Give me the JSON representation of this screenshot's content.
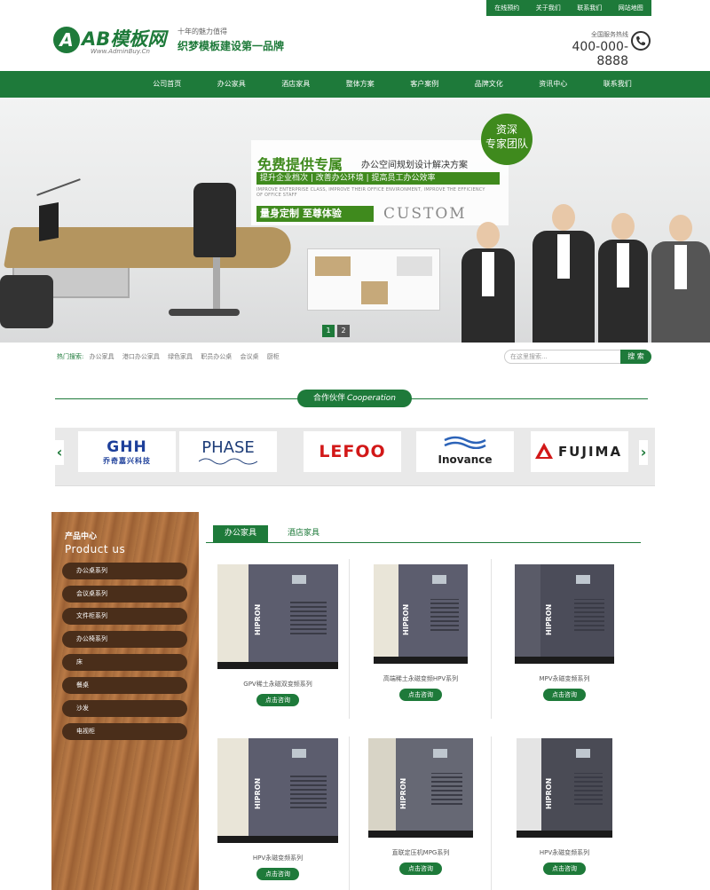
{
  "top_links": [
    "在线预约",
    "关于我们",
    "联系我们",
    "网站地图"
  ],
  "logo": {
    "mark": "A",
    "text": "AB模板网",
    "url": "Www.AdminBuy.Cn"
  },
  "tagline": {
    "line1": "十年的魅力值得",
    "line2": "织梦模板建设第一品牌"
  },
  "hotline": {
    "label": "全国服务热线",
    "number": "400-000-8888"
  },
  "nav": [
    "公司首页",
    "办公家具",
    "酒店家具",
    "整体方案",
    "客户案例",
    "品牌文化",
    "资讯中心",
    "联系我们"
  ],
  "banner": {
    "headline_bold": "免费提供专属",
    "headline_rest": "办公空间规划设计解决方案",
    "strip": "提升企业档次 | 改善办公环境 | 提高员工办公效率",
    "english": "IMPROVE ENTERPRISE CLASS, IMPROVE THEIR OFFICE ENVIRONMENT, IMPROVE THE EFFICIENCY OF OFFICE STAFF",
    "pill": "量身定制 至尊体验",
    "custom": "CUSTOM",
    "badge_line1": "资深",
    "badge_line2": "专家团队",
    "pages": [
      "1",
      "2"
    ]
  },
  "hot_search": {
    "label": "热门搜索:",
    "keywords": [
      "办公家具",
      "港口办公家具",
      "绿色家具",
      "职员办公桌",
      "会议桌",
      "厨柜"
    ]
  },
  "search": {
    "placeholder": "在这里搜索...",
    "button": "搜 索"
  },
  "cooperation": {
    "title_cn": "合作伙伴",
    "title_en": "Cooperation"
  },
  "brands": [
    {
      "name": "GHH",
      "sub": "乔奇嘉兴科技"
    },
    {
      "name": "PHASE",
      "sub": ""
    },
    {
      "name": "LEFOO",
      "sub": ""
    },
    {
      "name": "Inovance",
      "sub": ""
    },
    {
      "name": "FUJIMA",
      "sub": ""
    }
  ],
  "sidebar": {
    "title_cn": "产品中心",
    "title_en": "Product us",
    "items": [
      "办公桌系列",
      "会议桌系列",
      "文件柜系列",
      "办公椅系列",
      "床",
      "餐桌",
      "沙发",
      "电视柜"
    ]
  },
  "tabs": [
    "办公家具",
    "酒店家具"
  ],
  "products": [
    {
      "name": "GPV稀土永磁双变频系列",
      "button": "点击咨询",
      "brand_text": "HIPRON"
    },
    {
      "name": "高端稀土永磁变频HPV系列",
      "button": "点击咨询",
      "brand_text": "HIPRON"
    },
    {
      "name": "MPV永磁变频系列",
      "button": "点击咨询",
      "brand_text": "HIPRON"
    },
    {
      "name": "HPV永磁变频系列",
      "button": "点击咨询",
      "brand_text": "HIPRON"
    },
    {
      "name": "直联定压机MPG系列",
      "button": "点击咨询",
      "brand_text": "HIPRON"
    },
    {
      "name": "HPV永磁变频系列",
      "button": "点击咨询",
      "brand_text": "HIPRON"
    }
  ],
  "colors": {
    "brand_green": "#1e7a3a",
    "banner_green": "#3f8a1d",
    "wood": "#a46a3c",
    "sidebar_pill": "#4a2e1a"
  }
}
